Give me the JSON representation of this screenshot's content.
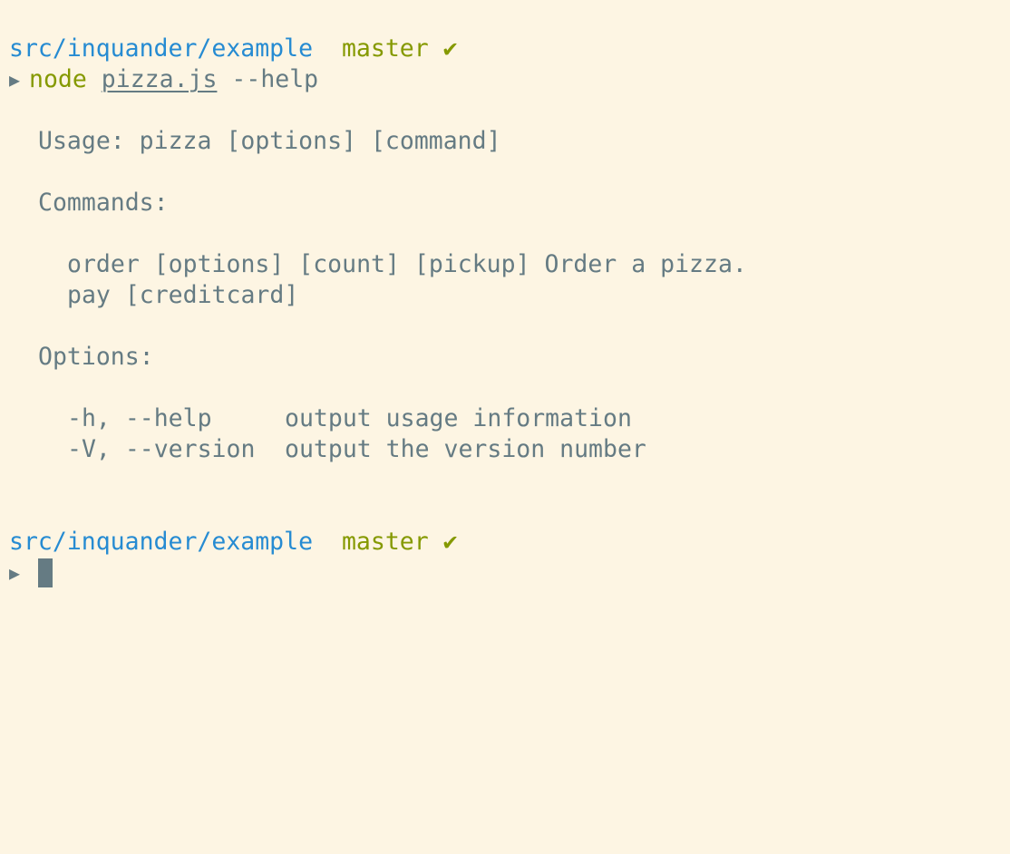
{
  "prompt1": {
    "path": "src/inquander/example",
    "branch": "master",
    "check": "✔",
    "arrow": "▶"
  },
  "command": {
    "program": "node",
    "file": "pizza.js",
    "args": "--help"
  },
  "output": {
    "usage": "Usage: pizza [options] [command]",
    "commands_heading": "Commands:",
    "commands": [
      "order [options] [count] [pickup] Order a pizza.",
      "pay [creditcard]"
    ],
    "options_heading": "Options:",
    "options": [
      {
        "flag": "-h, --help",
        "desc": "output usage information"
      },
      {
        "flag": "-V, --version",
        "desc": "output the version number"
      }
    ]
  },
  "prompt2": {
    "path": "src/inquander/example",
    "branch": "master",
    "check": "✔",
    "arrow": "▶"
  },
  "colors": {
    "background": "#fdf5e3",
    "text": "#657b83",
    "path": "#268bd2",
    "branch": "#859900"
  }
}
